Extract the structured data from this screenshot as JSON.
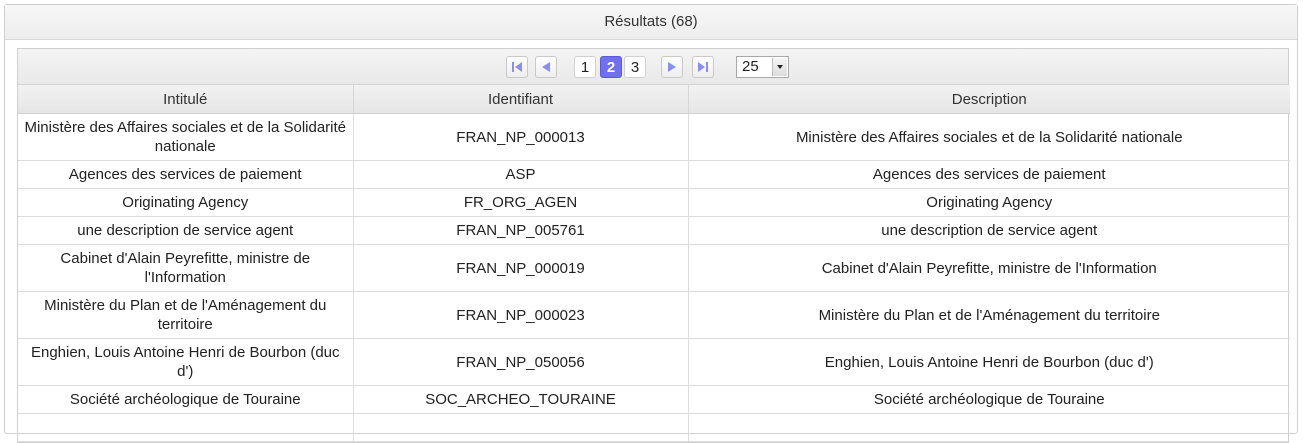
{
  "panel": {
    "title": "Résultats (68)"
  },
  "paginator": {
    "first_icon": "first-page-icon",
    "prev_icon": "prev-page-icon",
    "next_icon": "next-page-icon",
    "last_icon": "last-page-icon",
    "pages": [
      "1",
      "2",
      "3"
    ],
    "current_page": "2",
    "rows_per_page": "25",
    "accent_color": "#6f6ff0"
  },
  "table": {
    "columns": [
      "Intitulé",
      "Identifiant",
      "Description"
    ],
    "rows": [
      {
        "intitule": "Ministère des Affaires sociales et de la Solidarité nationale",
        "identifiant": "FRAN_NP_000013",
        "description": "Ministère des Affaires sociales et de la Solidarité nationale"
      },
      {
        "intitule": "Agences des services de paiement",
        "identifiant": "ASP",
        "description": "Agences des services de paiement"
      },
      {
        "intitule": "Originating Agency",
        "identifiant": "FR_ORG_AGEN",
        "description": "Originating Agency"
      },
      {
        "intitule": "une description de service agent",
        "identifiant": "FRAN_NP_005761",
        "description": "une description de service agent"
      },
      {
        "intitule": "Cabinet d'Alain Peyrefitte, ministre de l'Information",
        "identifiant": "FRAN_NP_000019",
        "description": "Cabinet d'Alain Peyrefitte, ministre de l'Information"
      },
      {
        "intitule": "Ministère du Plan et de l'Aménagement du territoire",
        "identifiant": "FRAN_NP_000023",
        "description": "Ministère du Plan et de l'Aménagement du territoire"
      },
      {
        "intitule": "Enghien, Louis Antoine Henri de Bourbon (duc d')",
        "identifiant": "FRAN_NP_050056",
        "description": "Enghien, Louis Antoine Henri de Bourbon (duc d')"
      },
      {
        "intitule": "Société archéologique de Touraine",
        "identifiant": "SOC_ARCHEO_TOURAINE",
        "description": "Société archéologique de Touraine"
      },
      {
        "intitule": "",
        "identifiant": "",
        "description": ""
      }
    ]
  }
}
